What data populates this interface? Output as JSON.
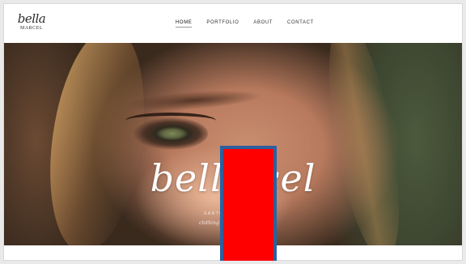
{
  "logo": {
    "script": "bella",
    "sub": "MARCEL"
  },
  "nav": {
    "items": [
      {
        "label": "HOME",
        "active": true
      },
      {
        "label": "PORTFOLIO",
        "active": false
      },
      {
        "label": "ABOUT",
        "active": false
      },
      {
        "label": "CONTACT",
        "active": false
      }
    ]
  },
  "hero": {
    "title": "bella        cel",
    "subtitle": "SARTOR",
    "tagline": "clothing"
  },
  "colors": {
    "redaction_fill": "#ff0000",
    "redaction_border": "#2e5f9e"
  }
}
